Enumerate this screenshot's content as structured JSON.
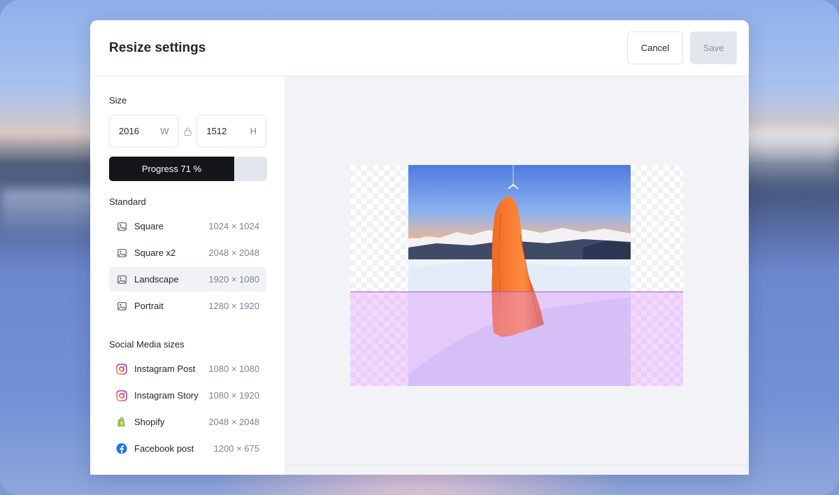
{
  "header": {
    "title": "Resize settings",
    "cancel_label": "Cancel",
    "save_label": "Save"
  },
  "size": {
    "label": "Size",
    "width_value": "2016",
    "width_unit": "W",
    "height_value": "1512",
    "height_unit": "H"
  },
  "progress": {
    "label": "Progress 71 %",
    "value_percent": 79
  },
  "standard": {
    "label": "Standard",
    "items": [
      {
        "name": "Square",
        "dims": "1024 × 1024",
        "icon": "image-icon"
      },
      {
        "name": "Square x2",
        "dims": "2048 × 2048",
        "icon": "image-icon"
      },
      {
        "name": "Landscape",
        "dims": "1920 × 1080",
        "icon": "image-icon",
        "selected": true
      },
      {
        "name": "Portrait",
        "dims": "1280 × 1920",
        "icon": "image-icon"
      }
    ]
  },
  "social": {
    "label": "Social Media sizes",
    "items": [
      {
        "name": "Instagram Post",
        "dims": "1080 × 1080",
        "icon": "instagram-icon"
      },
      {
        "name": "Instagram Story",
        "dims": "1080 × 1920",
        "icon": "instagram-icon"
      },
      {
        "name": "Shopify",
        "dims": "2048 × 2048",
        "icon": "shopify-icon"
      },
      {
        "name": "Facebook post",
        "dims": "1200 × 675",
        "icon": "facebook-icon"
      }
    ]
  },
  "colors": {
    "accent_dark": "#14161b",
    "overlay": "#e296ff",
    "overlay_line": "#9b5fd6",
    "facebook": "#1877f2",
    "shopify": "#95bf47"
  }
}
